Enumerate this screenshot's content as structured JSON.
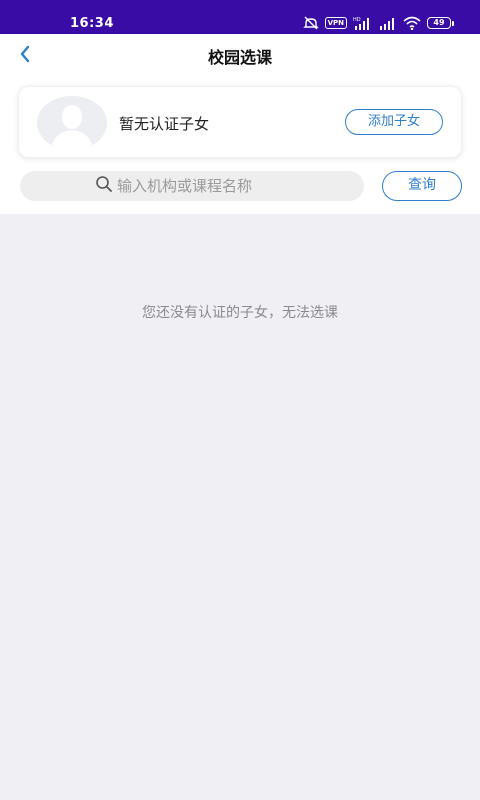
{
  "status_bar": {
    "time": "16:34",
    "vpn": "VPN",
    "battery": "49"
  },
  "header": {
    "title": "校园选课"
  },
  "child_card": {
    "status_text": "暂无认证子女",
    "add_child_label": "添加子女"
  },
  "search": {
    "placeholder": "输入机构或课程名称",
    "query_label": "查询"
  },
  "empty_state": {
    "message": "您还没有认证的子女，无法选课"
  },
  "colors": {
    "status_bar_bg": "#3a0ca6",
    "accent": "#2f7fd1",
    "page_bg": "#f0eff4"
  }
}
